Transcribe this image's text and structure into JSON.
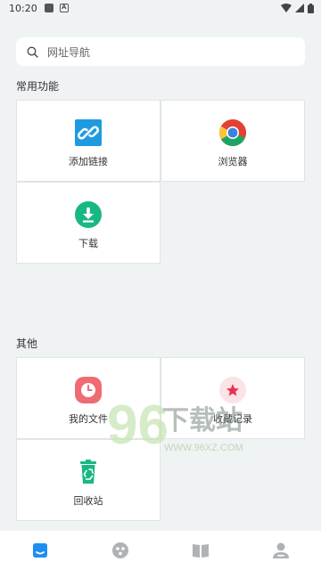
{
  "status_bar": {
    "time": "10:20",
    "icons": [
      "notification-square-icon",
      "notification-a-icon",
      "wifi-icon",
      "signal-icon",
      "battery-icon"
    ]
  },
  "search": {
    "placeholder": "网址导航",
    "icon": "search-icon"
  },
  "sections": {
    "common": {
      "title": "常用功能",
      "items": [
        {
          "label": "添加链接",
          "icon": "link-icon",
          "color": "#1e9be0"
        },
        {
          "label": "浏览器",
          "icon": "chrome-browser-icon",
          "color": "#e34133"
        },
        {
          "label": "下载",
          "icon": "download-icon",
          "color": "#19b784"
        }
      ]
    },
    "other": {
      "title": "其他",
      "items": [
        {
          "label": "我的文件",
          "icon": "clock-file-icon",
          "color": "#f06a73"
        },
        {
          "label": "收藏记录",
          "icon": "star-favorite-icon",
          "color": "#e8324f"
        },
        {
          "label": "回收站",
          "icon": "recycle-bin-icon",
          "color": "#19b784"
        }
      ]
    }
  },
  "watermark": {
    "text": "96下载站",
    "url": "WWW.96XZ.COM"
  },
  "bottom_nav": {
    "items": [
      {
        "icon": "home-icon",
        "active": true
      },
      {
        "icon": "discover-icon",
        "active": false
      },
      {
        "icon": "book-icon",
        "active": false
      },
      {
        "icon": "profile-icon",
        "active": false
      }
    ],
    "active_color": "#1e8ff0",
    "inactive_color": "#b0b3b6"
  }
}
